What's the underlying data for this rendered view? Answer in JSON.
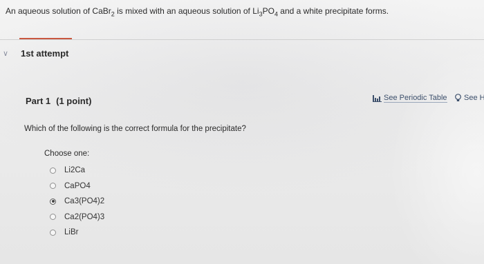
{
  "question": {
    "prefix": "An aqueous solution of CaBr",
    "sub1": "2",
    "middle": " is mixed with an aqueous solution of Li",
    "sub2": "3",
    "po": "PO",
    "sub3": "4",
    "suffix": " and a white precipitate forms."
  },
  "attempt": {
    "label": "1st attempt"
  },
  "part": {
    "title": "Part 1",
    "points": "(1 point)"
  },
  "tools": {
    "periodic_table": "See Periodic Table",
    "hint": "See H"
  },
  "prompt": "Which of the following is the correct formula for the precipitate?",
  "choose_label": "Choose one:",
  "options": [
    {
      "label": "Li2Ca",
      "selected": false
    },
    {
      "label": "CaPO4",
      "selected": false
    },
    {
      "label": "Ca3(PO4)2",
      "selected": true
    },
    {
      "label": "Ca2(PO4)3",
      "selected": false
    },
    {
      "label": "LiBr",
      "selected": false
    }
  ],
  "colors": {
    "accent": "#c9573f",
    "link": "#3c4f6b"
  },
  "icons": {
    "attempt_toggle": "chevron-down-icon",
    "periodic": "periodic-table-icon",
    "hint": "lightbulb-icon"
  }
}
